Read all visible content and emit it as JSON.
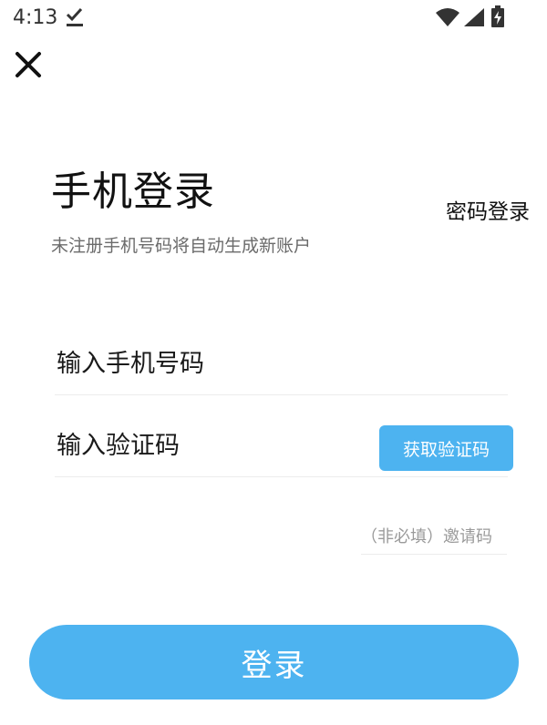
{
  "status_bar": {
    "time": "4:13",
    "icons": [
      "download-done-icon",
      "wifi-icon",
      "signal-icon",
      "battery-charging-icon"
    ]
  },
  "header": {
    "close_icon": "close-icon"
  },
  "title": "手机登录",
  "password_login_label": "密码登录",
  "subtitle": "未注册手机号码将自动生成新账户",
  "phone_input": {
    "value": "",
    "placeholder": "输入手机号码"
  },
  "code_input": {
    "value": "",
    "placeholder": "输入验证码"
  },
  "get_code_label": "获取验证码",
  "invite_input": {
    "value": "",
    "placeholder": "（非必填）邀请码"
  },
  "login_label": "登录",
  "colors": {
    "accent": "#4db3f0",
    "subtitle_text": "#6b6b6b",
    "divider": "#ececec"
  }
}
